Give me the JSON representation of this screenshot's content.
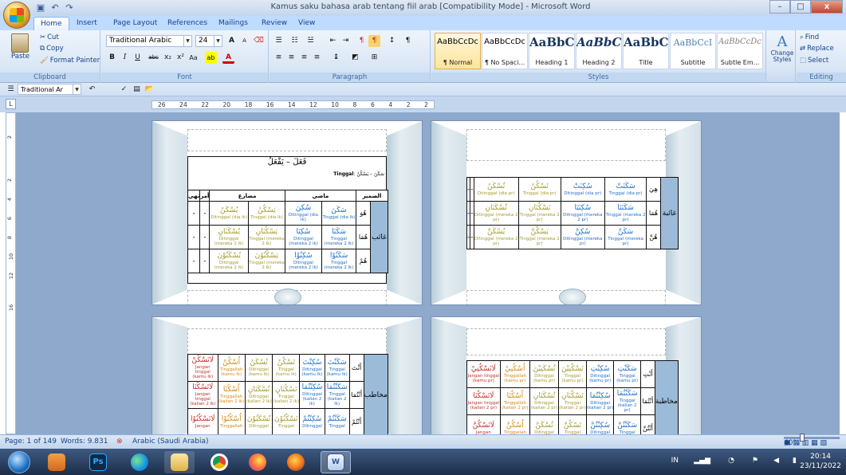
{
  "window": {
    "title": "Kamus saku bahasa arab tentang fiil arab [Compatibility Mode] - Microsoft Word",
    "minimize": "–",
    "maximize": "□",
    "close": "x"
  },
  "tabs": [
    "Home",
    "Insert",
    "Page Layout",
    "References",
    "Mailings",
    "Review",
    "View"
  ],
  "ribbon": {
    "clipboard": {
      "label": "Clipboard",
      "paste": "Paste",
      "cut": "Cut",
      "copy": "Copy",
      "format_painter": "Format Painter"
    },
    "font": {
      "label": "Font",
      "family": "Traditional Arabic",
      "size": "24"
    },
    "paragraph": {
      "label": "Paragraph"
    },
    "styles": {
      "label": "Styles",
      "items": [
        {
          "sample": "AaBbCcDc",
          "name": "¶ Normal"
        },
        {
          "sample": "AaBbCcDc",
          "name": "¶ No Spaci..."
        },
        {
          "sample": "AaBbC",
          "name": "Heading 1"
        },
        {
          "sample": "AaBbCc",
          "name": "Heading 2"
        },
        {
          "sample": "AaBbC",
          "name": "Title"
        },
        {
          "sample": "AaBbCcI",
          "name": "Subtitle"
        },
        {
          "sample": "AaBbCcDc",
          "name": "Subtle Em..."
        }
      ],
      "change_styles": "Change Styles"
    },
    "editing": {
      "label": "Editing",
      "find": "Find",
      "replace": "Replace",
      "select": "Select"
    }
  },
  "qbar": {
    "font": "Traditional Ar"
  },
  "ruler": {
    "h": [
      "26",
      "24",
      "22",
      "20",
      "18",
      "16",
      "14",
      "12",
      "10",
      "8",
      "6",
      "4",
      "2",
      "2"
    ],
    "v": [
      "2",
      "2",
      "4",
      "6",
      "8",
      "10",
      "12",
      "16"
    ]
  },
  "page1": {
    "heading": "فَعَلَ – يَفْعَلُ",
    "tinggal": "Tinggal",
    "verb_label": "سَكَنَ – يَسْكُنُ",
    "headers": [
      "الضمير",
      "ماضي",
      "مضارع",
      "أمر",
      "نهي"
    ],
    "group": "غائب",
    "rows": [
      {
        "pron": "هُوَ",
        "cells": [
          [
            "سَكَنَ",
            "Tinggal (dia lk)",
            "blue"
          ],
          [
            "سُكِنَ",
            "Ditinggal (dia lk)",
            "blue"
          ],
          [
            "يَسْكُنُ",
            "Tinggal (dia lk)",
            "olive"
          ],
          [
            "يُسْكَنُ",
            "Ditinggal (dia lk)",
            "olive"
          ]
        ]
      },
      {
        "pron": "هُمَا",
        "cells": [
          [
            "سَكَنَا",
            "Tinggal (mereka 2 lk)",
            "blue"
          ],
          [
            "سُكِنَا",
            "Ditinggal (mereka 2 lk)",
            "blue"
          ],
          [
            "يَسْكُنَانِ",
            "Tinggal (mereka 2 lk)",
            "olive"
          ],
          [
            "يُسْكَنَانِ",
            "Ditinggal (mereka 2 lk)",
            "olive"
          ]
        ]
      },
      {
        "pron": "هُمْ",
        "cells": [
          [
            "سَكَنُوْا",
            "Tinggal (mereka 2 lk)",
            "blue"
          ],
          [
            "سُكِنُوْا",
            "Ditinggal (mereka 2 lk)",
            "blue"
          ],
          [
            "يَسْكُنُوْنَ",
            "Tinggal (mereka 2 lk)",
            "olive"
          ],
          [
            "يُسْكَنُوْنَ",
            "Ditinggal (mereka 2 lk)",
            "olive"
          ]
        ]
      }
    ]
  },
  "page2": {
    "group": "غائبة",
    "rows": [
      {
        "pron": "هِيَ",
        "cells": [
          [
            "سَكَنَتْ",
            "Tinggal (dia pr)",
            "blue"
          ],
          [
            "سُكِنَتْ",
            "Ditinggal (dia pr)",
            "blue"
          ],
          [
            "تَسْكُنُ",
            "Tinggal (dia pr)",
            "olive"
          ],
          [
            "تُسْكَنُ",
            "Ditinggal (dia pr)",
            "olive"
          ]
        ]
      },
      {
        "pron": "هُمَا",
        "cells": [
          [
            "سَكَنَتَا",
            "Tinggal (mereka 2 pr)",
            "blue"
          ],
          [
            "سُكِنَتَا",
            "Ditinggal (mereka 2 pr)",
            "blue"
          ],
          [
            "تَسْكُنَانِ",
            "Tinggal (mereka 2 pr)",
            "olive"
          ],
          [
            "تُسْكَنَانِ",
            "Ditinggal (mereka 2 pr)",
            "olive"
          ]
        ]
      },
      {
        "pron": "هُنَّ",
        "cells": [
          [
            "سَكَنَّ",
            "Tinggal (mereka pr)",
            "blue"
          ],
          [
            "سُكِنَّ",
            "Ditinggal (mereka pr)",
            "blue"
          ],
          [
            "يَسْكُنَّ",
            "Tinggal (mereka 2 pr)",
            "olive"
          ],
          [
            "يُسْكَنَّ",
            "Ditinggal (mereka 2 pr)",
            "olive"
          ]
        ]
      }
    ]
  },
  "page3": {
    "group": "مخاطب",
    "rows": [
      {
        "pron": "أَنْتَ",
        "cells": [
          [
            "سَكَنْتَ",
            "Tinggal (kamu lk)",
            "blue"
          ],
          [
            "سُكِنْتَ",
            "Ditinggal (kamu lk)",
            "blue"
          ],
          [
            "تَسْكُنُ",
            "Tinggal (kamu lk)",
            "olive"
          ],
          [
            "تُسْكَنُ",
            "Ditinggal (kamu lk)",
            "olive"
          ],
          [
            "اُسْكُنْ",
            "Tinggallah (kamu lk)",
            "orange"
          ],
          [
            "لَاتَسْكُنْ",
            "Jangan tinggal (kamu lk)",
            "red"
          ]
        ]
      },
      {
        "pron": "أَنْتُمَا",
        "cells": [
          [
            "سَكَنْتُمَا",
            "Tinggal (kalian 2 lk)",
            "blue"
          ],
          [
            "سُكِنْتُمَا",
            "Ditinggal (kalian 2 lk)",
            "blue"
          ],
          [
            "تَسْكُنَانِ",
            "Tinggal (kalian 2 lk)",
            "olive"
          ],
          [
            "تُسْكَنَانِ",
            "Ditinggal (kalian 2 lk)",
            "olive"
          ],
          [
            "اُسْكُنَا",
            "Tinggallah (kalian 2 lk)",
            "orange"
          ],
          [
            "لَاتَسْكُنَا",
            "Jangan tinggal (kalian 2 lk)",
            "red"
          ]
        ]
      },
      {
        "pron": "أَنْتُمْ",
        "cells": [
          [
            "سَكَنْتُمْ",
            "Tinggal",
            "blue"
          ],
          [
            "سُكِنْتُمْ",
            "Ditinggal",
            "blue"
          ],
          [
            "تَسْكُنُوْنَ",
            "Tinggal",
            "olive"
          ],
          [
            "تُسْكَنُوْنَ",
            "Ditinggal",
            "olive"
          ],
          [
            "اُسْكُنُوْا",
            "Tinggallah",
            "orange"
          ],
          [
            "لَاتَسْكُنُوْا",
            "Jangan",
            "red"
          ]
        ]
      }
    ]
  },
  "page4": {
    "group": "مخاطبة",
    "rows": [
      {
        "pron": "أَنْتِ",
        "cells": [
          [
            "سَكَنْتِ",
            "Tinggal (kamu pr)",
            "blue"
          ],
          [
            "سُكِنْتِ",
            "Ditinggal (kamu pr)",
            "blue"
          ],
          [
            "تَسْكُنِيْنَ",
            "Tinggal (kamu pr)",
            "olive"
          ],
          [
            "تُسْكَنِيْنَ",
            "Ditinggal (kamu pr)",
            "olive"
          ],
          [
            "اُسْكُنِيْ",
            "Tinggallah (kamu pr)",
            "orange"
          ],
          [
            "لَاتَسْكُنِيْ",
            "Jangan tinggal (kamu pr)",
            "red"
          ]
        ]
      },
      {
        "pron": "أَنْتُمَا",
        "cells": [
          [
            "سَكَنْتُمَا",
            "Tinggal (kalian 2 pr)",
            "blue"
          ],
          [
            "سُكِنْتُمَا",
            "Ditinggal (kalian 2 pr)",
            "blue"
          ],
          [
            "تَسْكُنَانِ",
            "Tinggal (kalian 2 pr)",
            "olive"
          ],
          [
            "تُسْكَنَانِ",
            "Ditinggal (kalian 2 pr)",
            "olive"
          ],
          [
            "اُسْكُنَا",
            "Tinggallah (kalian 2 pr)",
            "orange"
          ],
          [
            "لَاتَسْكُنَا",
            "Jangan tinggal (kalian 2 pr)",
            "red"
          ]
        ]
      },
      {
        "pron": "أَنْتُنَّ",
        "cells": [
          [
            "سَكَنْتُنَّ",
            "Tinggal",
            "blue"
          ],
          [
            "سُكِنْتُنَّ",
            "Ditinggal",
            "blue"
          ],
          [
            "تَسْكُنَّ",
            "Tinggal",
            "olive"
          ],
          [
            "تُسْكَنَّ",
            "Ditinggal",
            "olive"
          ],
          [
            "اُسْكُنَّ",
            "Tinggallah",
            "orange"
          ],
          [
            "لَاتَسْكُنَّ",
            "Jangan",
            "red"
          ]
        ]
      }
    ]
  },
  "status": {
    "page": "Page: 1 of 149",
    "words": "Words: 9.831",
    "lang": "Arabic (Saudi Arabia)",
    "zoom": "40%"
  },
  "taskbar": {
    "lang": "IN",
    "time": "20:14",
    "date": "23/11/2022",
    "ps": "Ps"
  }
}
